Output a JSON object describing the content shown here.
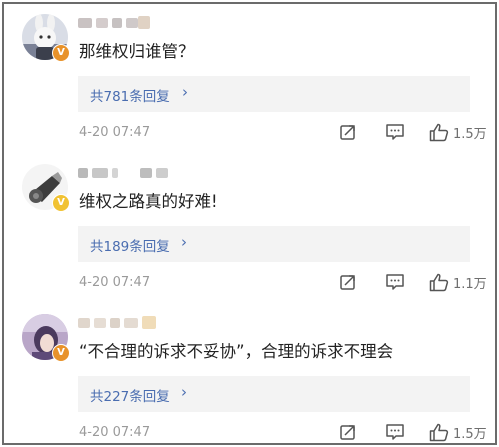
{
  "comments": [
    {
      "text": "那维权归谁管？",
      "replies_label": "共781条回复",
      "chevron": "›",
      "timestamp": "4-20 07:47",
      "likes": "1.5万",
      "badge": "V",
      "badge_color": "#e8922a",
      "avatar_icon": "cartoon-bunny-avatar"
    },
    {
      "text": "维权之路真的好难!",
      "replies_label": "共189条回复",
      "chevron": "›",
      "timestamp": "4-20 07:47",
      "likes": "1.1万",
      "badge": "V",
      "badge_color": "#f1c232",
      "avatar_icon": "whistle-avatar"
    },
    {
      "text": "“不合理的诉求不妥协”，合理的诉求不理会",
      "replies_label": "共227条回复",
      "chevron": "›",
      "timestamp": "4-20 07:47",
      "likes": "1.5万",
      "badge": "V",
      "badge_color": "#e8922a",
      "avatar_icon": "anime-character-avatar"
    }
  ],
  "colors": {
    "reply_link": "#4a6db0",
    "reply_background": "#f3f3f3",
    "timestamp": "#9a9a9a",
    "comment_text": "#222222"
  }
}
